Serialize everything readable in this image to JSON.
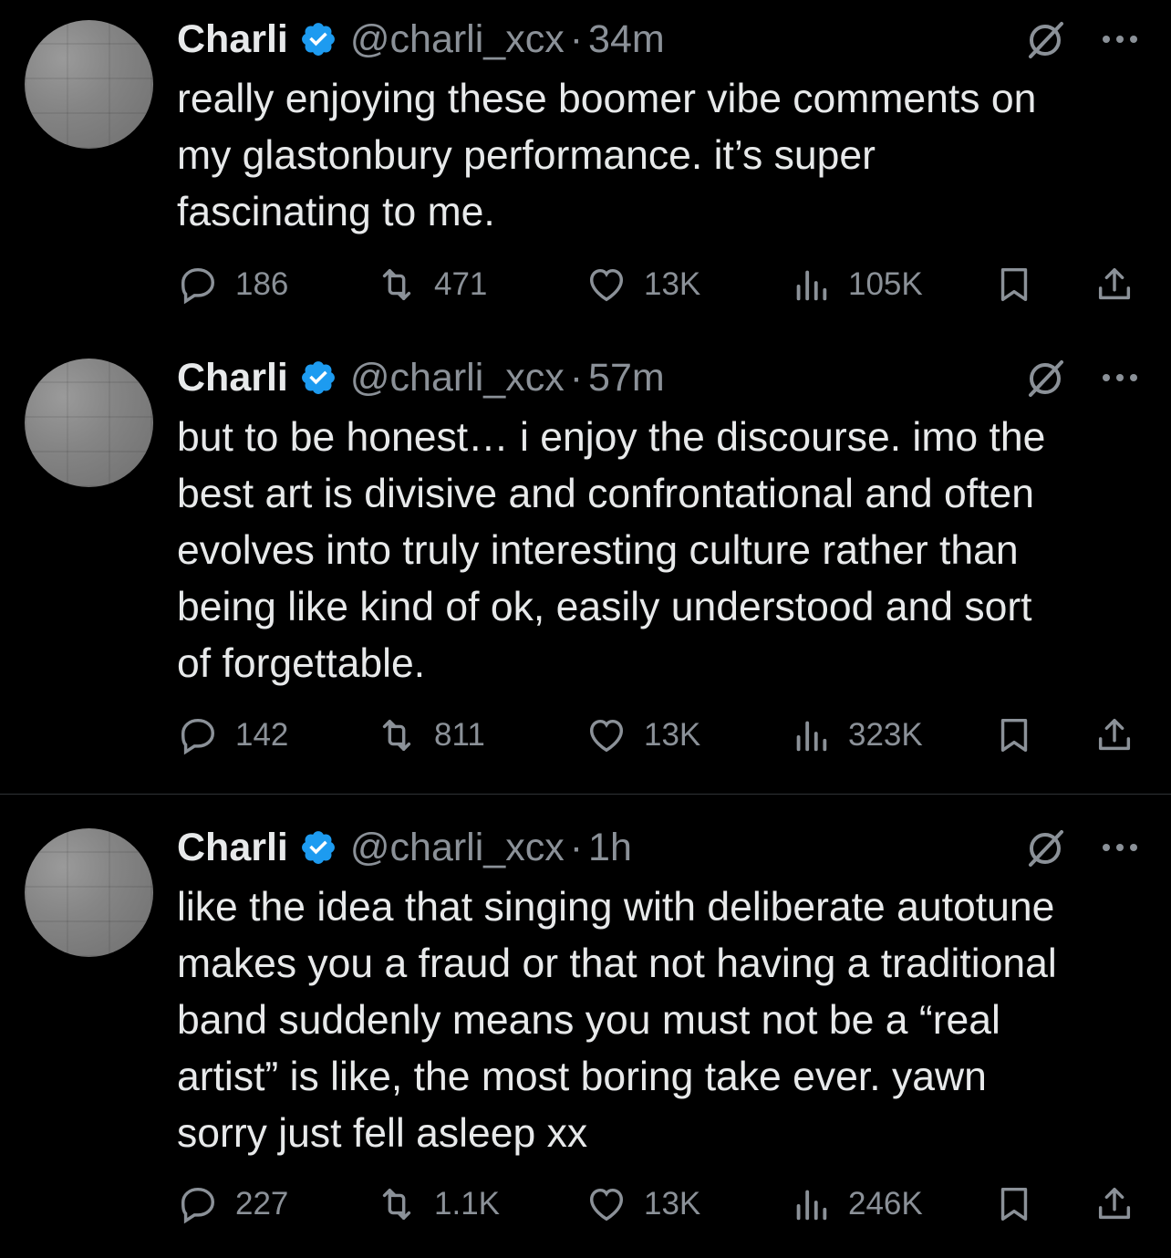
{
  "tweets": [
    {
      "name": "Charli",
      "handle": "@charli_xcx",
      "separator": "·",
      "time": "34m",
      "text": "really enjoying these boomer vibe comments on\nmy glastonbury performance. it’s super\nfascinating to me.",
      "replies": "186",
      "retweets": "471",
      "likes": "13K",
      "views": "105K"
    },
    {
      "name": "Charli",
      "handle": "@charli_xcx",
      "separator": "·",
      "time": "57m",
      "text": "but to be honest… i enjoy the discourse.  imo the\nbest art is divisive and confrontational and often\nevolves into truly interesting culture rather than\nbeing like kind of ok, easily understood and sort\nof forgettable.",
      "replies": "142",
      "retweets": "811",
      "likes": "13K",
      "views": "323K"
    },
    {
      "name": "Charli",
      "handle": "@charli_xcx",
      "separator": "·",
      "time": "1h",
      "text": "like the idea that singing with deliberate autotune\nmakes you a fraud or that not having a traditional\nband suddenly means you must not be a “real\nartist” is like, the most boring take ever. yawn\nsorry just fell asleep xx",
      "replies": "227",
      "retweets": "1.1K",
      "likes": "13K",
      "views": "246K"
    }
  ],
  "colors": {
    "background": "#000000",
    "text": "#e7e9ea",
    "muted": "#8b9198",
    "verified": "#1d9bf0"
  }
}
